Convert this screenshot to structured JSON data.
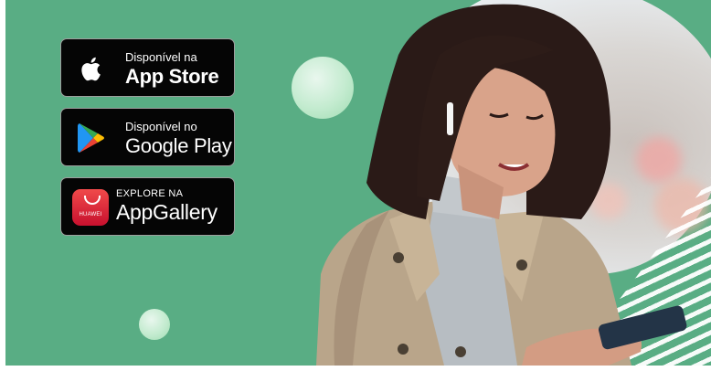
{
  "colors": {
    "background": "#59ad84",
    "badge_bg": "#050505",
    "badge_border": "#9e9e9e",
    "huawei_red": "#cf1b2b"
  },
  "badges": {
    "app_store": {
      "small": "Disponível na",
      "big": "App Store",
      "icon": "apple-icon"
    },
    "google_play": {
      "small": "Disponível no",
      "big": "Google Play",
      "icon": "google-play-icon"
    },
    "app_gallery": {
      "small": "EXPLORE NA",
      "big": "AppGallery",
      "icon": "huawei-appgallery-icon",
      "icon_text": "HUAWEI"
    }
  },
  "hero": {
    "image": "woman-smiling-at-phone-with-earbud"
  }
}
